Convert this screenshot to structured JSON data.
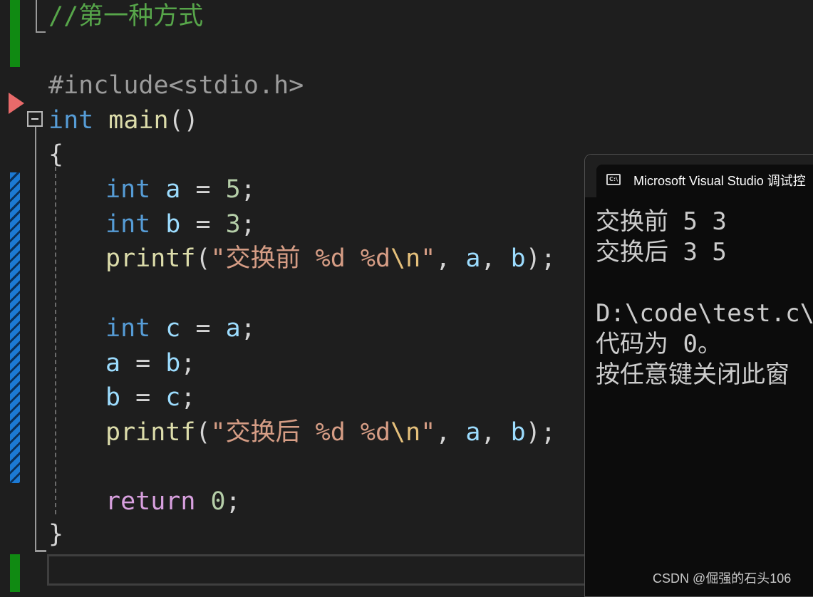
{
  "editor": {
    "comment": "//第一种方式",
    "include_directive": "#include",
    "include_header": "<stdio.h>",
    "main_type": "int",
    "main_name": "main",
    "main_parens": "()",
    "open_brace": "{",
    "close_brace": "}",
    "decl_type": "int",
    "var_a": "a",
    "var_b": "b",
    "var_c": "c",
    "eq": " = ",
    "val_a": "5",
    "val_b": "3",
    "semi": ";",
    "printf_name": "printf",
    "paren_open": "(",
    "paren_close": ")",
    "comma_sep": ", ",
    "str1_text": "\"交换前 %d %d",
    "str2_text": "\"交换后 %d %d",
    "newline_escape": "\\n",
    "str_close": "\"",
    "return_kw": "return",
    "return_value": "0"
  },
  "console": {
    "title": "Microsoft Visual Studio 调试控",
    "icon_text": "C:\\",
    "lines": [
      "交换前 5 3",
      "交换后 3 5",
      "",
      "D:\\code\\test.c\\",
      "代码为 0。",
      "按任意键关闭此窗"
    ]
  },
  "watermark": "CSDN @倔强的石头106",
  "colors": {
    "background": "#1e1e1e",
    "keyword": "#569cd6",
    "function": "#dcdcaa",
    "variable": "#9cdcfe",
    "number": "#b5cea8",
    "string": "#d69d85",
    "comment": "#57a64a",
    "change_saved": "#108a12",
    "change_unsaved": "#1c7ad4",
    "breakpoint_arrow": "#e86a6a"
  }
}
